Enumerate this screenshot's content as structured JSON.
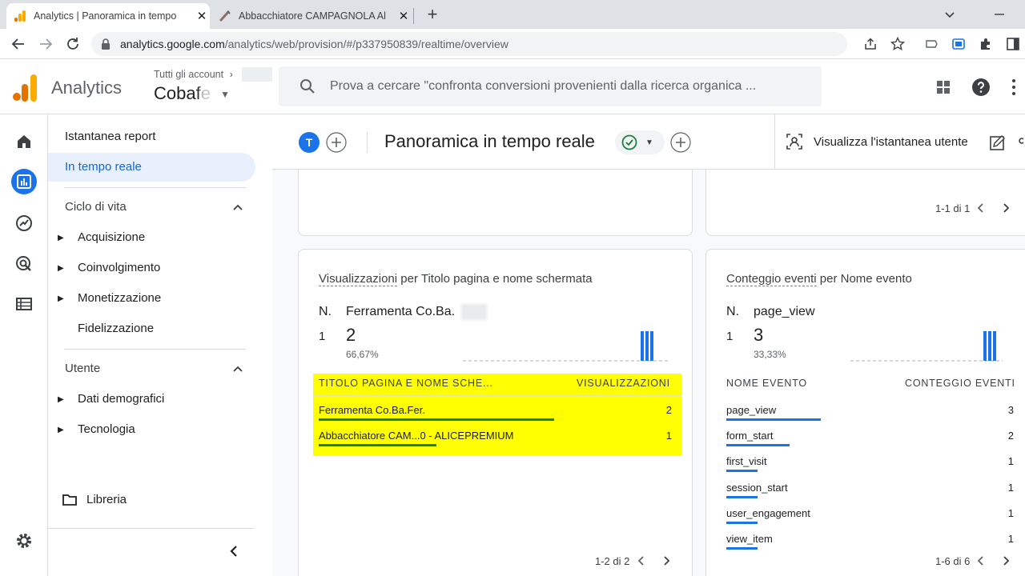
{
  "browser": {
    "tabs": [
      {
        "title": "Analytics | Panoramica in tempo",
        "active": true
      },
      {
        "title": "Abbacchiatore CAMPAGNOLA Al",
        "active": false
      }
    ],
    "url_host": "analytics.google.com",
    "url_path": "/analytics/web/provision/#/p337950839/realtime/overview"
  },
  "header": {
    "app_title": "Analytics",
    "account_breadcrumb": "Tutti gli account",
    "property_name": "Cobafe",
    "search_placeholder": "Prova a cercare \"confronta conversioni provenienti dalla ricerca organica ..."
  },
  "nav": {
    "snapshot": "Istantanea report",
    "realtime": "In tempo reale",
    "lifecycle": "Ciclo di vita",
    "lifecycle_items": [
      "Acquisizione",
      "Coinvolgimento",
      "Monetizzazione",
      "Fidelizzazione"
    ],
    "user": "Utente",
    "user_items": [
      "Dati demografici",
      "Tecnologia"
    ],
    "library": "Libreria"
  },
  "subheader": {
    "avatar_letter": "T",
    "page_title": "Panoramica in tempo reale",
    "user_snapshot": "Visualizza l'istantanea utente"
  },
  "top_right_card": {
    "pagination": "1-1 di 1"
  },
  "views_card": {
    "title_part1": "Visualizzazioni",
    "title_part2": " per Titolo pagina e nome schermata",
    "rank_label": "N.",
    "top_item": "Ferramenta Co.Ba.",
    "rank": "1",
    "value": "2",
    "percent": "66,67%",
    "col_name": "TITOLO PAGINA E NOME SCHE...",
    "col_value": "VISUALIZZAZIONI",
    "rows": [
      {
        "name": "Ferramenta Co.Ba.Fer.",
        "value": "2",
        "share": 1.0
      },
      {
        "name": "Abbacchiatore CAM...0 - ALICEPREMIUM",
        "value": "1",
        "share": 0.5
      }
    ],
    "pagination": "1-2 di 2"
  },
  "events_card": {
    "title_part1": "Conteggio eventi",
    "title_part2": " per Nome evento",
    "rank_label": "N.",
    "top_item": "page_view",
    "rank": "1",
    "value": "3",
    "percent": "33,33%",
    "col_name": "NOME EVENTO",
    "col_value": "CONTEGGIO EVENTI",
    "rows": [
      {
        "name": "page_view",
        "value": "3",
        "share": 1.0
      },
      {
        "name": "form_start",
        "value": "2",
        "share": 0.67
      },
      {
        "name": "first_visit",
        "value": "1",
        "share": 0.33
      },
      {
        "name": "session_start",
        "value": "1",
        "share": 0.33
      },
      {
        "name": "user_engagement",
        "value": "1",
        "share": 0.33
      },
      {
        "name": "view_item",
        "value": "1",
        "share": 0.33
      }
    ],
    "pagination": "1-6 di 6"
  },
  "colors": {
    "accent": "#1a73e8",
    "highlight": "#ffff00",
    "views_bar": "#188038",
    "check": "#188038",
    "logo_orange": "#f9ab00",
    "logo_dark": "#e37400"
  }
}
